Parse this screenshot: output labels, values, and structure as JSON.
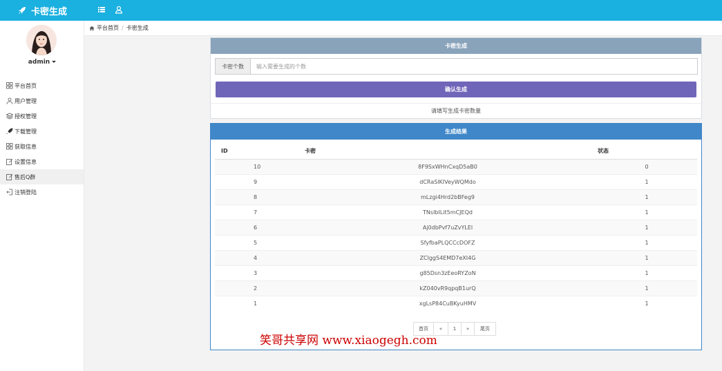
{
  "app": {
    "title": "卡密生成"
  },
  "sidebar": {
    "username": "admin",
    "items": [
      {
        "label": "平台首页",
        "icon": "grid-icon"
      },
      {
        "label": "用户管理",
        "icon": "user-icon"
      },
      {
        "label": "授权管理",
        "icon": "layers-icon"
      },
      {
        "label": "下载管理",
        "icon": "rocket-icon"
      },
      {
        "label": "获取信息",
        "icon": "grid-icon"
      },
      {
        "label": "设置信息",
        "icon": "edit-icon"
      },
      {
        "label": "售后Q群",
        "icon": "edit-icon"
      },
      {
        "label": "注销登陆",
        "icon": "logout-icon"
      }
    ]
  },
  "breadcrumb": {
    "home": "平台首页",
    "current": "卡密生成"
  },
  "generate_panel": {
    "title": "卡密生成",
    "count_label": "卡密个数",
    "count_placeholder": "输入需要生成的个数",
    "count_value": "",
    "confirm_label": "确认生成",
    "hint": "请填写生成卡密数量"
  },
  "results_panel": {
    "title": "生成结果",
    "columns": [
      "ID",
      "卡密",
      "状态"
    ],
    "rows": [
      {
        "id": "10",
        "key": "8F9SxWHnCxqD5aB0",
        "status": "0"
      },
      {
        "id": "9",
        "key": "dCRaSlKIVeyWQMdo",
        "status": "1"
      },
      {
        "id": "8",
        "key": "mLzgi4Hrd2bBFeg9",
        "status": "1"
      },
      {
        "id": "7",
        "key": "TNsIbILit5mCJEQd",
        "status": "1"
      },
      {
        "id": "6",
        "key": "Aj0dbPvf7uZvYLEl",
        "status": "1"
      },
      {
        "id": "5",
        "key": "SfyfbaPLQCCcDOFZ",
        "status": "1"
      },
      {
        "id": "4",
        "key": "ZClggS4EMD7eXI4G",
        "status": "1"
      },
      {
        "id": "3",
        "key": "g85Dsn3zEeoRYZoN",
        "status": "1"
      },
      {
        "id": "2",
        "key": "kZ040vR9qpqB1urQ",
        "status": "1"
      },
      {
        "id": "1",
        "key": "xgLsP84CuBKyuHMV",
        "status": "1"
      }
    ],
    "pagination": {
      "first": "首页",
      "prev": "«",
      "page": "1",
      "next": "»",
      "last": "尾页"
    }
  },
  "watermark": "笑哥共享网 www.xiaogegh.com",
  "colors": {
    "topbar": "#1ab0e0",
    "panel1_header": "#89a3bb",
    "panel2_header": "#3f87c8",
    "confirm_button": "#7066b9"
  }
}
